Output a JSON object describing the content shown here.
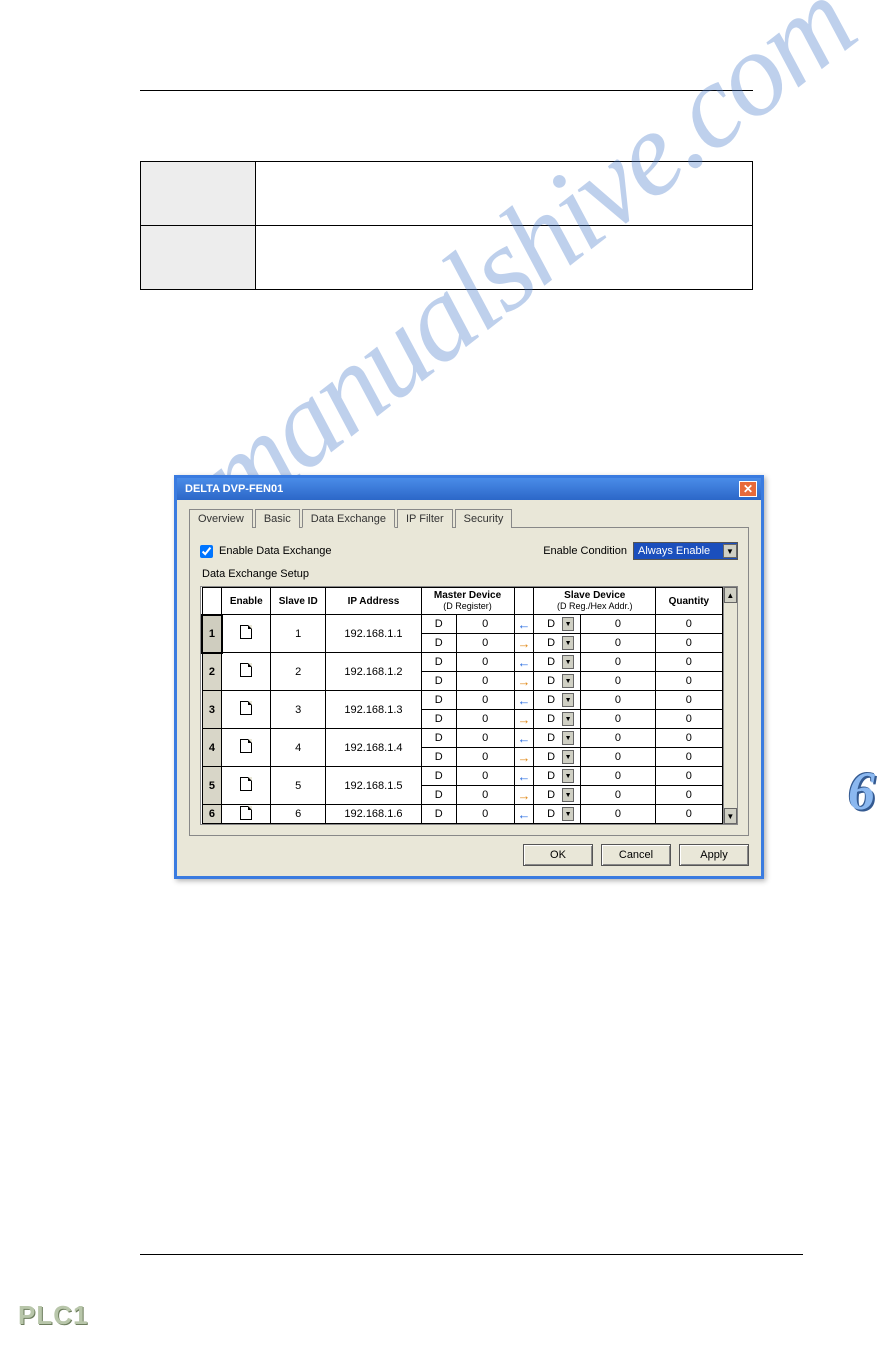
{
  "chapter_number": "6",
  "watermark": "manualshive.com",
  "footer_logo": "PLC1",
  "desc_rows": [
    {
      "label": "",
      "content": ""
    },
    {
      "label": "",
      "content": ""
    }
  ],
  "dialog": {
    "title": "DELTA DVP-FEN01",
    "tabs": [
      "Overview",
      "Basic",
      "Data Exchange",
      "IP Filter",
      "Security"
    ],
    "active_tab": 2,
    "enable_checkbox_label": "Enable Data Exchange",
    "enable_checked": true,
    "condition_label": "Enable Condition",
    "condition_value": "Always Enable",
    "setup_label": "Data Exchange Setup",
    "headers": {
      "enable": "Enable",
      "slave_id": "Slave ID",
      "ip": "IP Address",
      "master": "Master Device",
      "master_sub": "(D Register)",
      "slave": "Slave Device",
      "slave_sub": "(D Reg./Hex Addr.)",
      "qty": "Quantity"
    },
    "rows": [
      {
        "n": "1",
        "slave_id": "1",
        "ip": "192.168.1.1",
        "lines": [
          {
            "md": "D",
            "mv": "0",
            "dir": "in",
            "sd": "D",
            "sv": "0",
            "q": "0"
          },
          {
            "md": "D",
            "mv": "0",
            "dir": "out",
            "sd": "D",
            "sv": "0",
            "q": "0"
          }
        ]
      },
      {
        "n": "2",
        "slave_id": "2",
        "ip": "192.168.1.2",
        "lines": [
          {
            "md": "D",
            "mv": "0",
            "dir": "in",
            "sd": "D",
            "sv": "0",
            "q": "0"
          },
          {
            "md": "D",
            "mv": "0",
            "dir": "out",
            "sd": "D",
            "sv": "0",
            "q": "0"
          }
        ]
      },
      {
        "n": "3",
        "slave_id": "3",
        "ip": "192.168.1.3",
        "lines": [
          {
            "md": "D",
            "mv": "0",
            "dir": "in",
            "sd": "D",
            "sv": "0",
            "q": "0"
          },
          {
            "md": "D",
            "mv": "0",
            "dir": "out",
            "sd": "D",
            "sv": "0",
            "q": "0"
          }
        ]
      },
      {
        "n": "4",
        "slave_id": "4",
        "ip": "192.168.1.4",
        "lines": [
          {
            "md": "D",
            "mv": "0",
            "dir": "in",
            "sd": "D",
            "sv": "0",
            "q": "0"
          },
          {
            "md": "D",
            "mv": "0",
            "dir": "out",
            "sd": "D",
            "sv": "0",
            "q": "0"
          }
        ]
      },
      {
        "n": "5",
        "slave_id": "5",
        "ip": "192.168.1.5",
        "lines": [
          {
            "md": "D",
            "mv": "0",
            "dir": "in",
            "sd": "D",
            "sv": "0",
            "q": "0"
          },
          {
            "md": "D",
            "mv": "0",
            "dir": "out",
            "sd": "D",
            "sv": "0",
            "q": "0"
          }
        ]
      },
      {
        "n": "6",
        "slave_id": "6",
        "ip": "192.168.1.6",
        "lines": [
          {
            "md": "D",
            "mv": "0",
            "dir": "in",
            "sd": "D",
            "sv": "0",
            "q": "0"
          }
        ]
      }
    ],
    "buttons": {
      "ok": "OK",
      "cancel": "Cancel",
      "apply": "Apply"
    }
  }
}
